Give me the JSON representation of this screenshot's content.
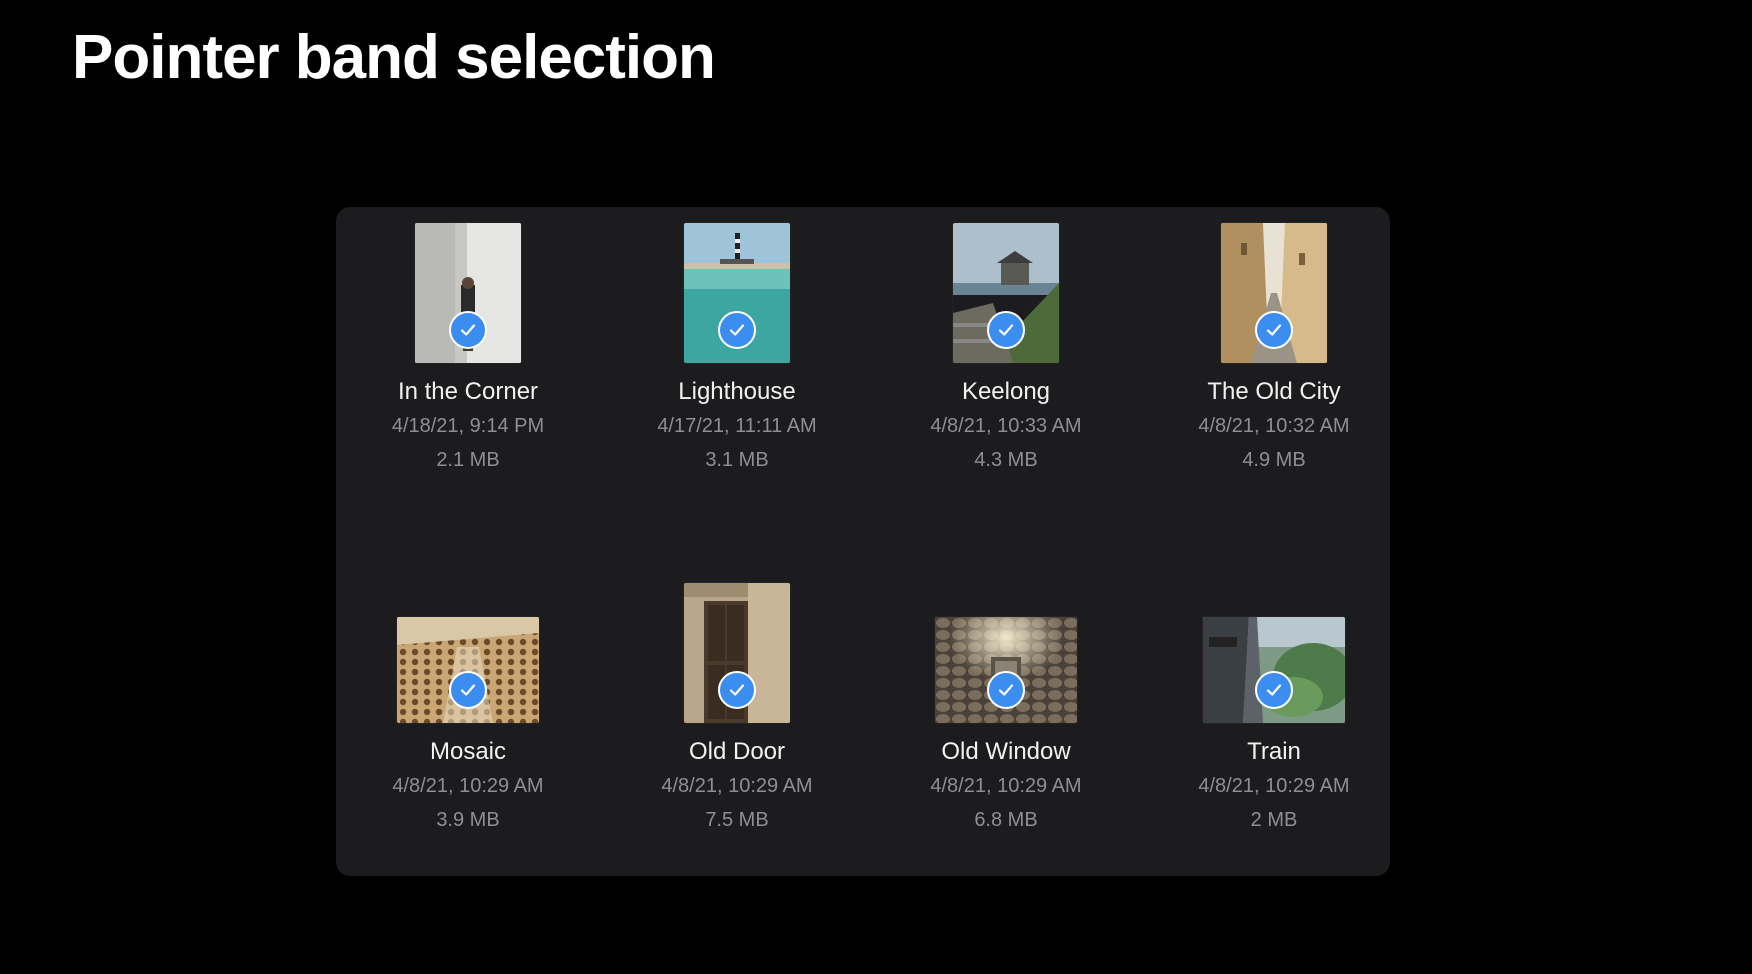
{
  "slide": {
    "title": "Pointer band selection"
  },
  "files": [
    {
      "name": "In the Corner",
      "date": "4/18/21, 9:14 PM",
      "size": "2.1 MB",
      "selected": true,
      "orientation": "portrait"
    },
    {
      "name": "Lighthouse",
      "date": "4/17/21, 11:11 AM",
      "size": "3.1 MB",
      "selected": true,
      "orientation": "portrait"
    },
    {
      "name": "Keelong",
      "date": "4/8/21, 10:33 AM",
      "size": "4.3 MB",
      "selected": true,
      "orientation": "portrait"
    },
    {
      "name": "The Old City",
      "date": "4/8/21, 10:32 AM",
      "size": "4.9 MB",
      "selected": true,
      "orientation": "portrait"
    },
    {
      "name": "Mosaic",
      "date": "4/8/21, 10:29 AM",
      "size": "3.9 MB",
      "selected": true,
      "orientation": "landscape"
    },
    {
      "name": "Old Door",
      "date": "4/8/21, 10:29 AM",
      "size": "7.5 MB",
      "selected": true,
      "orientation": "portrait"
    },
    {
      "name": "Old Window",
      "date": "4/8/21, 10:29 AM",
      "size": "6.8 MB",
      "selected": true,
      "orientation": "landscape"
    },
    {
      "name": "Train",
      "date": "4/8/21, 10:29 AM",
      "size": "2 MB",
      "selected": true,
      "orientation": "landscape"
    }
  ],
  "icons": {
    "selection_check": "checkmark-circle-icon"
  },
  "colors": {
    "background": "#000000",
    "panel": "#1c1c1e",
    "accent": "#3b8ef0",
    "secondary_text": "#8e8e93"
  }
}
